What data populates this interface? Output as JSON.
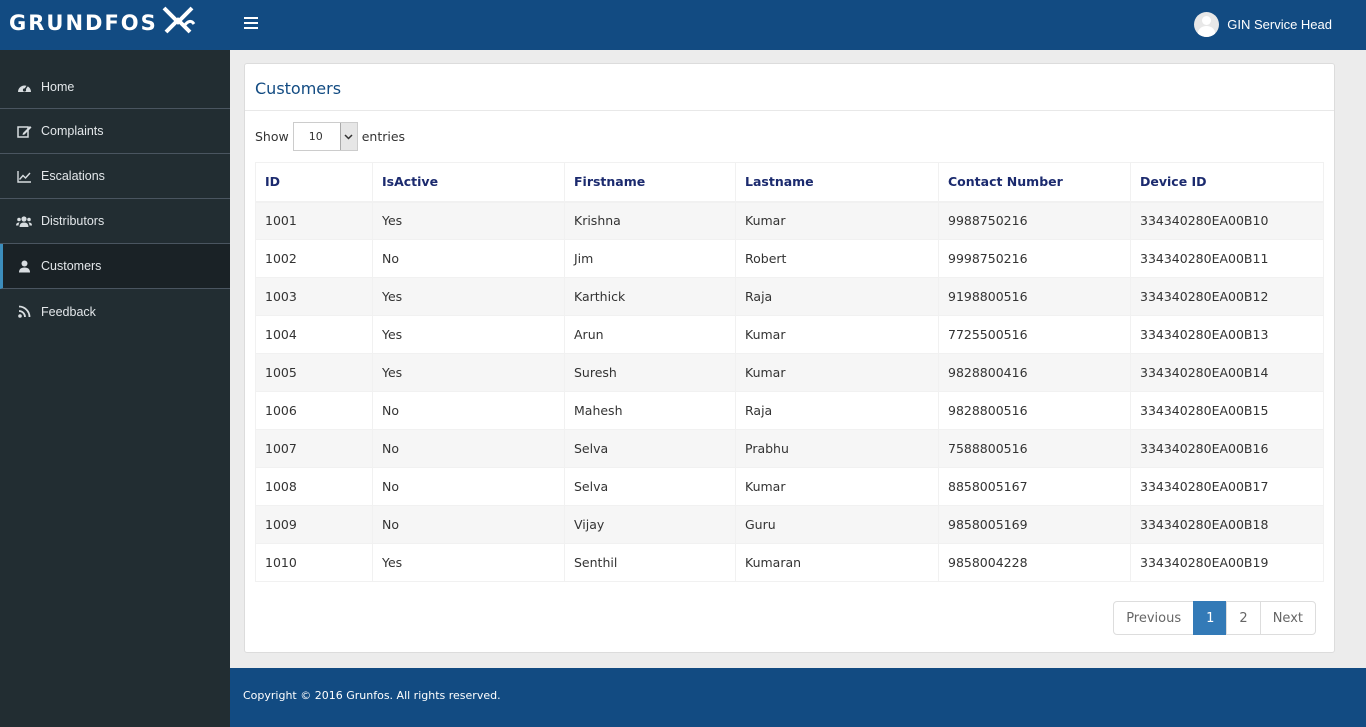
{
  "header": {
    "brand": "GRUNDFOS",
    "menu_icon": "hamburger-icon",
    "user_name": "GIN Service Head"
  },
  "sidebar": {
    "items": [
      {
        "label": "Home",
        "icon": "dashboard-icon"
      },
      {
        "label": "Complaints",
        "icon": "edit-icon"
      },
      {
        "label": "Escalations",
        "icon": "line-chart-icon"
      },
      {
        "label": "Distributors",
        "icon": "users-icon"
      },
      {
        "label": "Customers",
        "icon": "user-icon"
      },
      {
        "label": "Feedback",
        "icon": "rss-icon"
      }
    ],
    "active": "Customers"
  },
  "main": {
    "title": "Customers",
    "length": {
      "show": "Show",
      "value": "10",
      "entries": "entries"
    },
    "table": {
      "columns": [
        "ID",
        "IsActive",
        "Firstname",
        "Lastname",
        "Contact Number",
        "Device ID"
      ],
      "rows": [
        [
          "1001",
          "Yes",
          "Krishna",
          "Kumar",
          "9988750216",
          "334340280EA00B10"
        ],
        [
          "1002",
          "No",
          "Jim",
          "Robert",
          "9998750216",
          "334340280EA00B11"
        ],
        [
          "1003",
          "Yes",
          "Karthick",
          "Raja",
          "9198800516",
          "334340280EA00B12"
        ],
        [
          "1004",
          "Yes",
          "Arun",
          "Kumar",
          "7725500516",
          "334340280EA00B13"
        ],
        [
          "1005",
          "Yes",
          "Suresh",
          "Kumar",
          "9828800416",
          "334340280EA00B14"
        ],
        [
          "1006",
          "No",
          "Mahesh",
          "Raja",
          "9828800516",
          "334340280EA00B15"
        ],
        [
          "1007",
          "No",
          "Selva",
          "Prabhu",
          "7588800516",
          "334340280EA00B16"
        ],
        [
          "1008",
          "No",
          "Selva",
          "Kumar",
          "8858005167",
          "334340280EA00B17"
        ],
        [
          "1009",
          "No",
          "Vijay",
          "Guru",
          "9858005169",
          "334340280EA00B18"
        ],
        [
          "1010",
          "Yes",
          "Senthil",
          "Kumaran",
          "9858004228",
          "334340280EA00B19"
        ]
      ]
    },
    "pagination": {
      "previous": "Previous",
      "pages": [
        "1",
        "2"
      ],
      "current": "1",
      "next": "Next"
    }
  },
  "footer": {
    "text": "Copyright © 2016 Grunfos. All rights reserved."
  },
  "colors": {
    "header": "#124b82",
    "sidebar": "#222d32",
    "accent": "#337ab7",
    "table_header_text": "#1b2a6e"
  }
}
